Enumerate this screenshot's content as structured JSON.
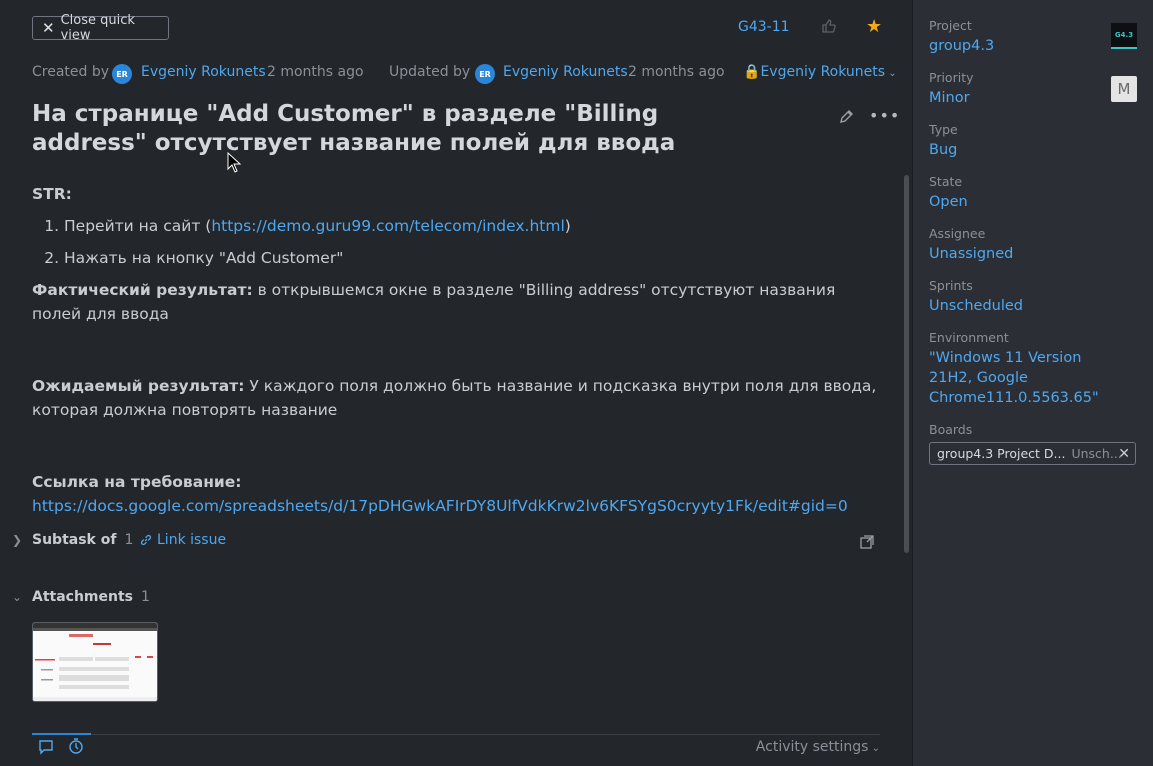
{
  "header": {
    "close_label": "Close quick view",
    "issue_id": "G43-11"
  },
  "meta": {
    "created_by_label": "Created by",
    "creator_initials": "ER",
    "creator_name": "Evgeniy Rokunets",
    "created_time": "2 months ago",
    "updated_by_label": "Updated by",
    "updater_initials": "ER",
    "updater_name": "Evgeniy Rokunets",
    "updated_time": "2 months ago",
    "visibility": "Evgeniy Rokunets"
  },
  "issue": {
    "title": "На странице \"Add Customer\" в разделе \"Billing address\" отсутствует название полей для ввода",
    "str_label": "STR:",
    "step1_prefix": "Перейти на сайт (",
    "step1_link": "https://demo.guru99.com/telecom/index.html",
    "step1_suffix": ")",
    "step2": "Нажать на кнопку \"Add Customer\"",
    "actual_label": "Фактический результат:",
    "actual_text": " в открывшемся окне в разделе \"Billing address\" отсутствуют названия полей для ввода",
    "expected_label": "Ожидаемый результат:",
    "expected_text": " У каждого поля должно быть название и подсказка внутри поля для ввода, которая должна повторять название",
    "req_label": "Ссылка на требование:",
    "req_link": "https://docs.google.com/spreadsheets/d/17pDHGwkAFIrDY8UlfVdkKrw2lv6KFSYgS0cryyty1Fk/edit#gid=0"
  },
  "subtask": {
    "title": "Subtask of",
    "count": "1",
    "link_issue": "Link issue"
  },
  "attachments": {
    "title": "Attachments",
    "count": "1"
  },
  "activity": {
    "settings_label": "Activity settings"
  },
  "sidebar": {
    "project_label": "Project",
    "project_value": "group4.3",
    "project_logo": "G4.3",
    "priority_label": "Priority",
    "priority_value": "Minor",
    "priority_avatar": "M",
    "type_label": "Type",
    "type_value": "Bug",
    "state_label": "State",
    "state_value": "Open",
    "assignee_label": "Assignee",
    "assignee_value": "Unassigned",
    "sprints_label": "Sprints",
    "sprints_value": "Unscheduled",
    "environment_label": "Environment",
    "environment_value": "\"Windows 11 Version 21H2, Google Chrome111.0.5563.65\"",
    "boards_label": "Boards",
    "board_name": "group4.3 Project D...",
    "board_sprint": "Unsch..."
  },
  "colors": {
    "accent": "#4fa8ef",
    "star": "#f4a81d",
    "background": "#23262b",
    "sidebar": "#2b2f35"
  }
}
